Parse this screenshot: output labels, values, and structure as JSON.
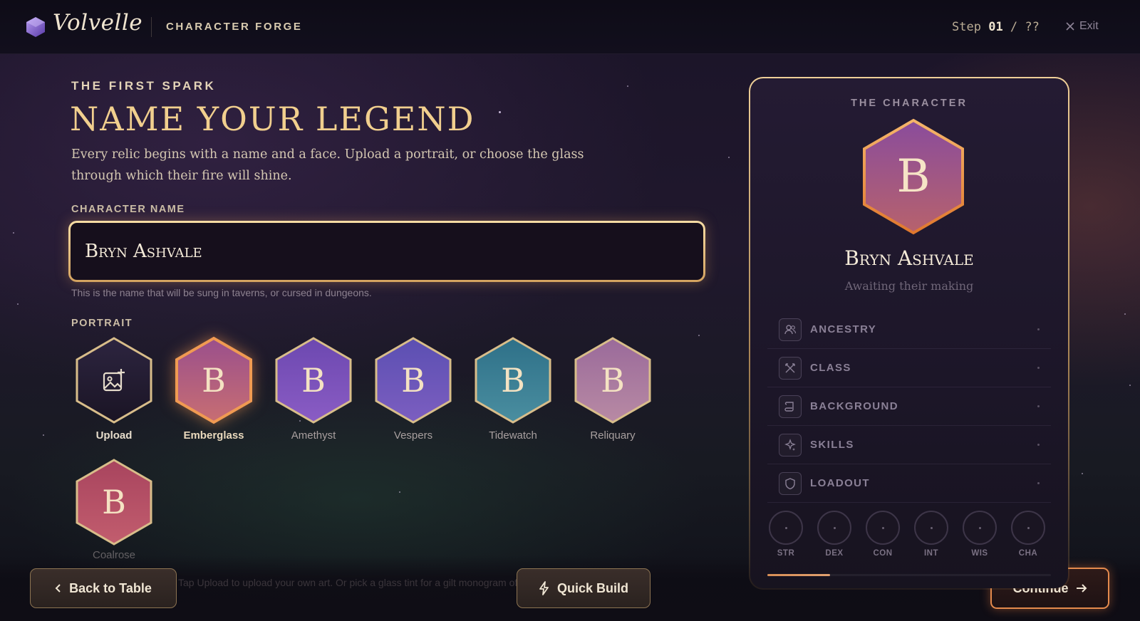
{
  "header": {
    "brand": "Volvelle",
    "section": "CHARACTER FORGE",
    "step_label": "Step",
    "step_current": "01",
    "step_sep": " / ",
    "step_total": "??",
    "exit_label": "Exit"
  },
  "intro": {
    "eyebrow": "THE FIRST SPARK",
    "title": "NAME YOUR LEGEND",
    "description": "Every relic begins with a name and a face. Upload a portrait, or choose the glass through which their fire will shine."
  },
  "name_field": {
    "label": "CHARACTER NAME",
    "value": "Bryn Ashvale",
    "hint": "This is the name that will be sung in taverns, or cursed in dungeons."
  },
  "portrait": {
    "label": "PORTRAIT",
    "letter": "B",
    "upload_label": "Upload",
    "selected": "Emberglass",
    "options": [
      {
        "name": "Emberglass",
        "colors": [
          "#9a4f8c",
          "#c86e72"
        ],
        "border": "#f09a52"
      },
      {
        "name": "Amethyst",
        "colors": [
          "#6c48b0",
          "#8a5cc4"
        ],
        "border": "#d8bd8a"
      },
      {
        "name": "Vespers",
        "colors": [
          "#5b4fb2",
          "#7c5ec0"
        ],
        "border": "#d8bd8a"
      },
      {
        "name": "Tidewatch",
        "colors": [
          "#2e7088",
          "#4a8ea0"
        ],
        "border": "#d8bd8a"
      },
      {
        "name": "Reliquary",
        "colors": [
          "#9a6a9a",
          "#b88aa4"
        ],
        "border": "#d8bd8a"
      },
      {
        "name": "Coalrose",
        "colors": [
          "#a8445e",
          "#c25d6e"
        ],
        "border": "#d8bd8a"
      }
    ],
    "ghost_hint": "Tap Upload to upload your own art. Or pick a glass tint for a gilt monogram of their initial."
  },
  "footer": {
    "back_label": "Back to Table",
    "quick_label": "Quick Build",
    "continue_label": "Continue"
  },
  "character_card": {
    "eyebrow": "THE CHARACTER",
    "letter": "B",
    "name": "Bryn Ashvale",
    "subtitle": "Awaiting their making",
    "rows": [
      {
        "label": "ANCESTRY",
        "icon": "people-icon",
        "value": "·"
      },
      {
        "label": "CLASS",
        "icon": "crossed-swords-icon",
        "value": "·"
      },
      {
        "label": "BACKGROUND",
        "icon": "scroll-icon",
        "value": "·"
      },
      {
        "label": "SKILLS",
        "icon": "sparkle-icon",
        "value": "·"
      },
      {
        "label": "LOADOUT",
        "icon": "shield-icon",
        "value": "·"
      }
    ],
    "stats": [
      "STR",
      "DEX",
      "CON",
      "INT",
      "WIS",
      "CHA"
    ],
    "progress": 0.22
  },
  "colors": {
    "accent_gold": "#f1cf8e",
    "accent_ember": "#e48a4d",
    "bg_dark": "#120f1d"
  }
}
